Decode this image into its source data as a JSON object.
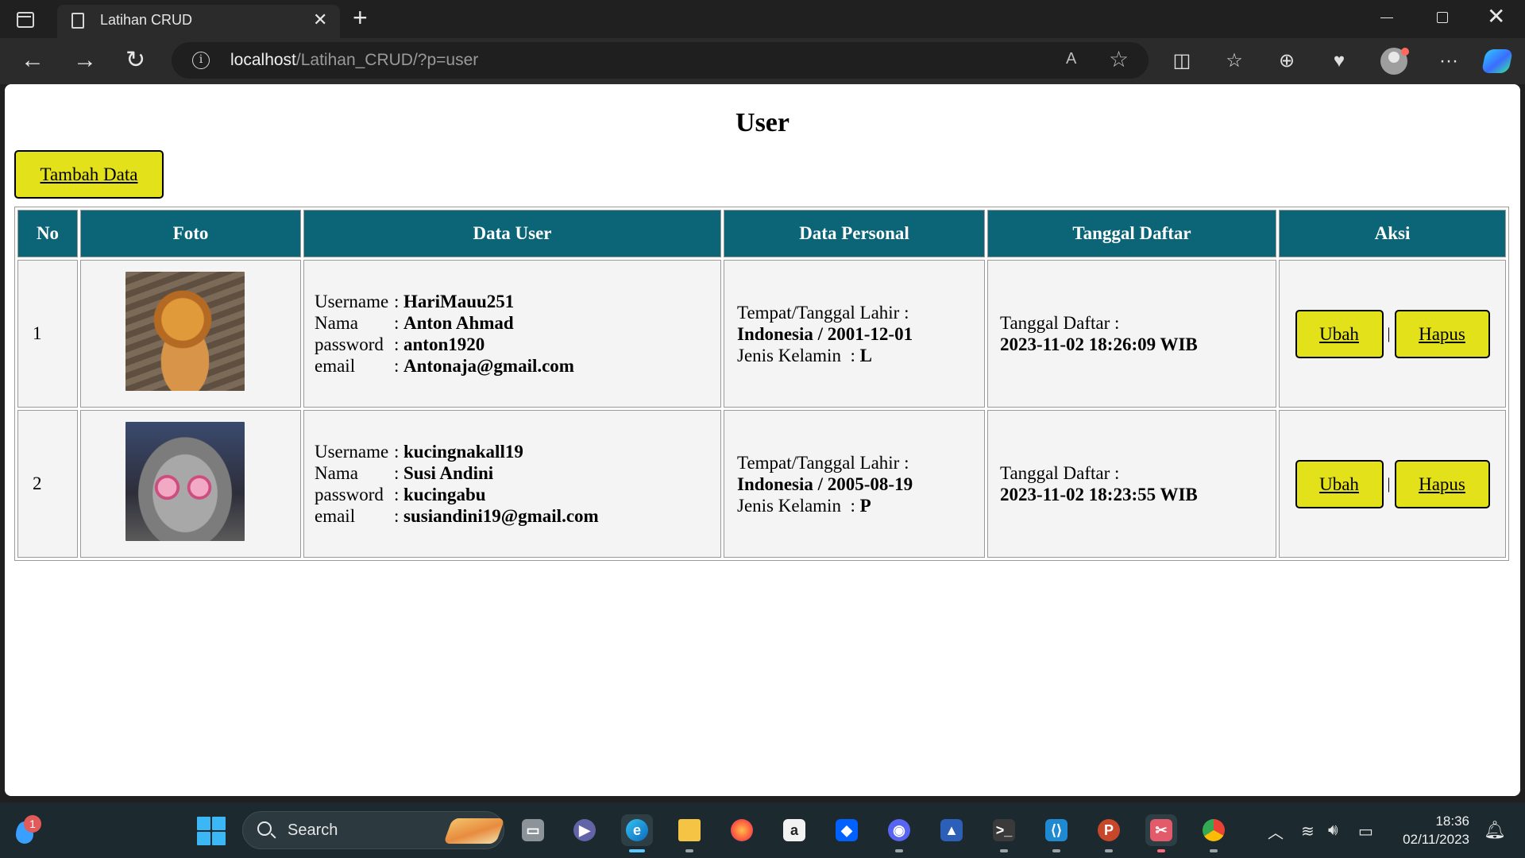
{
  "browser": {
    "tab_title": "Latihan CRUD",
    "url_host": "localhost",
    "url_path": "/Latihan_CRUD/?p=user"
  },
  "page": {
    "title": "User",
    "add_button": "Tambah Data",
    "table": {
      "headers": [
        "No",
        "Foto",
        "Data User",
        "Data Personal",
        "Tanggal Daftar",
        "Aksi"
      ],
      "field_labels": {
        "username": "Username",
        "nama": "Nama",
        "password": "password",
        "email": "email",
        "colon": ":",
        "ttl": "Tempat/Tanggal Lahir :",
        "jenis_kelamin": "Jenis Kelamin",
        "tanggal_daftar": "Tanggal Daftar :"
      },
      "rows": [
        {
          "no": "1",
          "photo": "tiger-cub",
          "username": "HariMauu251",
          "nama": "Anton Ahmad",
          "password": "anton1920",
          "email": "Antonaja@gmail.com",
          "ttl": "Indonesia / 2001-12-01",
          "jenis_kelamin": "L",
          "tanggal_daftar": "2023-11-02 18:26:09 WIB"
        },
        {
          "no": "2",
          "photo": "cat-with-heart-glasses",
          "username": "kucingnakall19",
          "nama": "Susi Andini",
          "password": "kucingabu",
          "email": "susiandini19@gmail.com",
          "ttl": "Indonesia / 2005-08-19",
          "jenis_kelamin": "P",
          "tanggal_daftar": "2023-11-02 18:23:55 WIB"
        }
      ],
      "actions": {
        "edit": "Ubah",
        "separator": "|",
        "delete": "Hapus"
      }
    }
  },
  "taskbar": {
    "search_label": "Search",
    "weather_badge": "1",
    "time": "18:36",
    "date": "02/11/2023"
  },
  "colors": {
    "header_bg": "#0c6577",
    "button_bg": "#e3e11a",
    "cell_bg": "#f4f4f4"
  }
}
